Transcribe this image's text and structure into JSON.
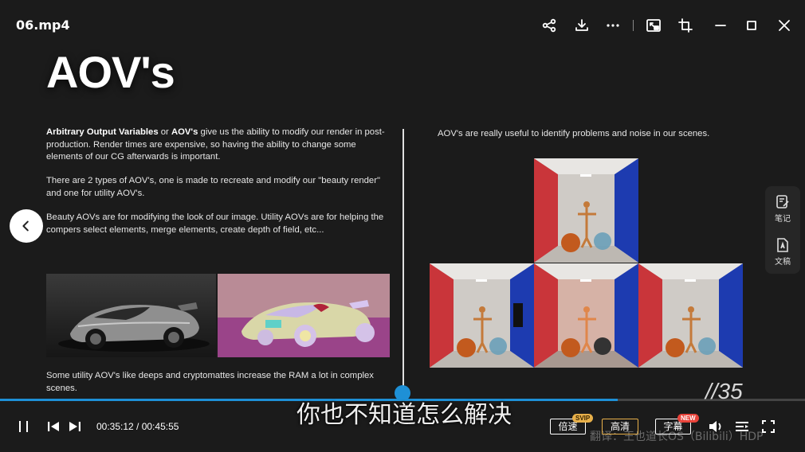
{
  "window": {
    "title": "06.mp4"
  },
  "slide": {
    "title": "AOV's",
    "para1_bold1": "Arbitrary Output Variables",
    "para1_or": " or ",
    "para1_bold2": "AOV's",
    "para1_rest": " give us the ability to modify our render in post-production. Render times are expensive, so having the ability to change some elements of our CG afterwards is important.",
    "para2": "There are 2 types of AOV's, one is made to recreate and modify our \"beauty render\" and one for utility AOV's.",
    "para3": "Beauty AOVs are for modifying the look of our image. Utility AOVs are for helping the compers select elements, merge elements, create depth of field, etc...",
    "para4": "Some utility AOV's like deeps and cryptomattes increase the RAM a lot in complex scenes.",
    "right_text": "AOV's are really useful to identify problems and noise in our scenes.",
    "slide_number": "//35"
  },
  "side_panel": {
    "notes_label": "笔记",
    "doc_label": "文稿"
  },
  "subtitle": "你也不知道怎么解决",
  "watermark": "翻译：王也道长OS（Bilibili）HDP",
  "player": {
    "current_time": "00:35:12",
    "total_time": "00:45:55",
    "time_display": "00:35:12 / 00:45:55",
    "progress": 0.767,
    "speed_label": "倍速",
    "speed_badge": "SVIP",
    "quality_label": "高清",
    "subtitle_label": "字幕",
    "subtitle_badge": "NEW"
  },
  "colors": {
    "accent": "#1e90d6",
    "quality_border": "#e8b04a",
    "svip_badge": "#e8b04a",
    "new_badge": "#e8433a"
  },
  "icons": [
    "share-icon",
    "download-icon",
    "more-icon",
    "picture-in-picture-icon",
    "crop-icon",
    "minimize-icon",
    "maximize-icon",
    "close-icon",
    "chevron-left-icon",
    "note-icon",
    "document-icon",
    "pause-icon",
    "previous-icon",
    "next-icon",
    "volume-icon",
    "playlist-icon",
    "fullscreen-icon"
  ]
}
